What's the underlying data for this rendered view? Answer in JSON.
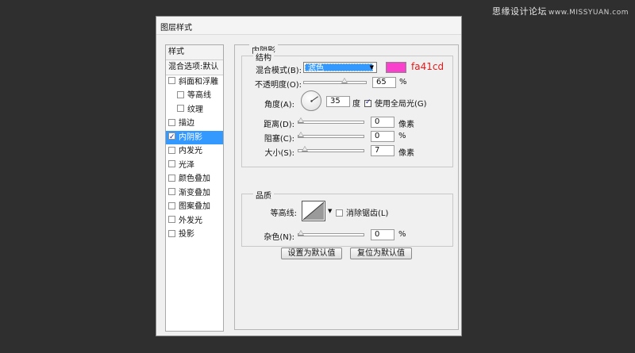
{
  "watermark": {
    "main": "思缘设计论坛",
    "site": "www.MISSYUAN.com"
  },
  "dialog": {
    "title": "图层样式"
  },
  "left_panel": {
    "header": "样式",
    "items": [
      {
        "label": "混合选项:默认",
        "checkbox": false,
        "checked": false,
        "sub": false,
        "selected": false
      },
      {
        "label": "斜面和浮雕",
        "checkbox": true,
        "checked": false,
        "sub": false,
        "selected": false
      },
      {
        "label": "等高线",
        "checkbox": true,
        "checked": false,
        "sub": true,
        "selected": false
      },
      {
        "label": "纹理",
        "checkbox": true,
        "checked": false,
        "sub": true,
        "selected": false
      },
      {
        "label": "描边",
        "checkbox": true,
        "checked": false,
        "sub": false,
        "selected": false
      },
      {
        "label": "内阴影",
        "checkbox": true,
        "checked": true,
        "sub": false,
        "selected": true
      },
      {
        "label": "内发光",
        "checkbox": true,
        "checked": false,
        "sub": false,
        "selected": false
      },
      {
        "label": "光泽",
        "checkbox": true,
        "checked": false,
        "sub": false,
        "selected": false
      },
      {
        "label": "颜色叠加",
        "checkbox": true,
        "checked": false,
        "sub": false,
        "selected": false
      },
      {
        "label": "渐变叠加",
        "checkbox": true,
        "checked": false,
        "sub": false,
        "selected": false
      },
      {
        "label": "图案叠加",
        "checkbox": true,
        "checked": false,
        "sub": false,
        "selected": false
      },
      {
        "label": "外发光",
        "checkbox": true,
        "checked": false,
        "sub": false,
        "selected": false
      },
      {
        "label": "投影",
        "checkbox": true,
        "checked": false,
        "sub": false,
        "selected": false
      }
    ]
  },
  "inner_shadow": {
    "title": "内阴影",
    "structure": {
      "title": "结构",
      "blend_mode_label": "混合模式(B):",
      "blend_mode_value": "滤色",
      "color": "#fa41cd",
      "color_label": "fa41cd",
      "opacity_label": "不透明度(O):",
      "opacity_value": "65",
      "opacity_fraction": 0.65,
      "opacity_unit": "%",
      "angle_label": "角度(A):",
      "angle_value": "35",
      "angle_unit": "度",
      "global_light_label": "使用全局光(G)",
      "global_light_checked": true,
      "distance_label": "距离(D):",
      "distance_value": "0",
      "distance_unit": "像素",
      "choke_label": "阻塞(C):",
      "choke_value": "0",
      "choke_unit": "%",
      "size_label": "大小(S):",
      "size_value": "7",
      "size_unit": "像素"
    },
    "quality": {
      "title": "品质",
      "contour_label": "等高线:",
      "anti_alias_label": "消除锯齿(L)",
      "anti_alias_checked": false,
      "noise_label": "杂色(N):",
      "noise_value": "0",
      "noise_unit": "%"
    },
    "buttons": {
      "set_default": "设置为默认值",
      "reset_default": "复位为默认值"
    }
  }
}
